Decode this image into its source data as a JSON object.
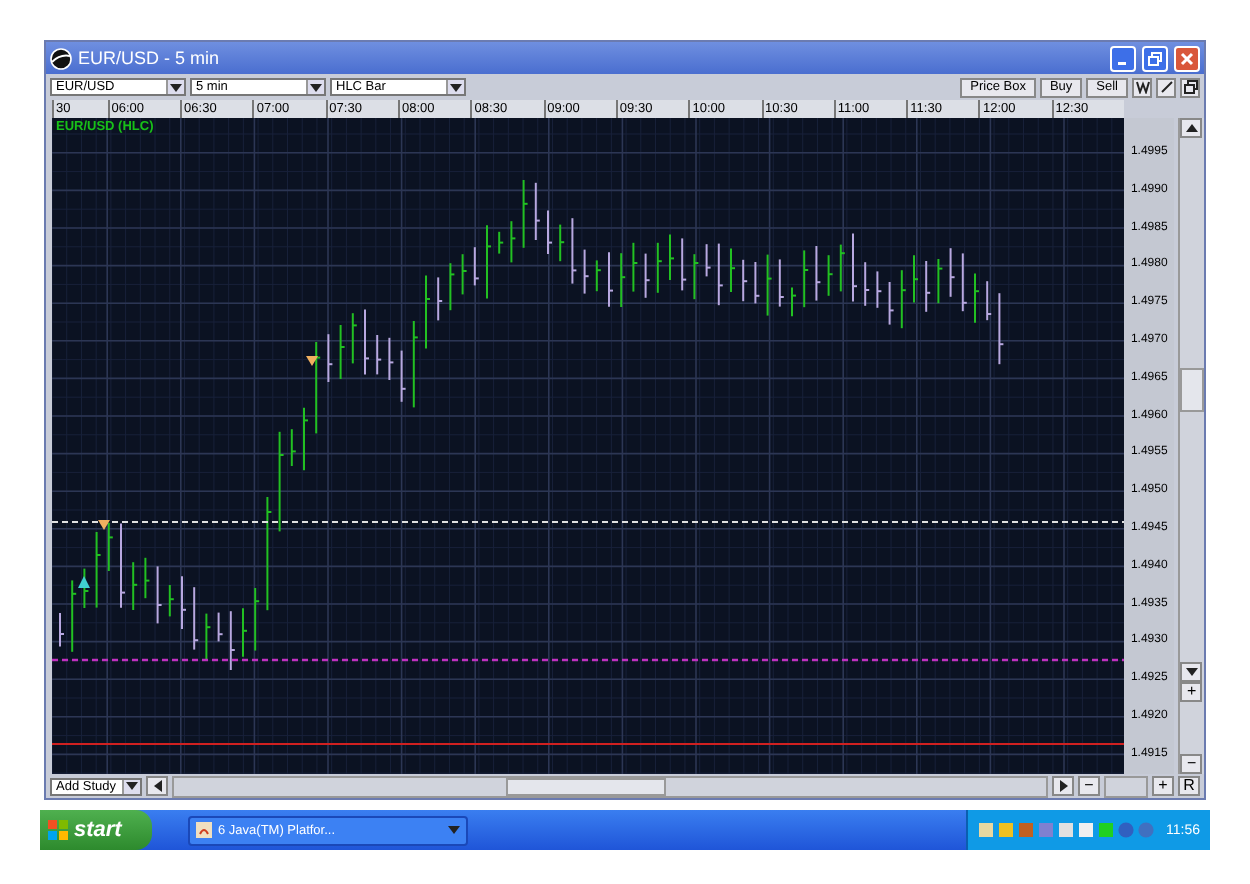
{
  "window": {
    "title": "EUR/USD - 5 min"
  },
  "toolbar": {
    "symbol": "EUR/USD",
    "interval": "5 min",
    "chart_type": "HLC Bar",
    "buttons": [
      "Price Box",
      "Buy",
      "Sell"
    ]
  },
  "time_axis": [
    "30",
    "06:00",
    "06:30",
    "07:00",
    "07:30",
    "08:00",
    "08:30",
    "09:00",
    "09:30",
    "10:00",
    "10:30",
    "11:00",
    "11:30",
    "12:00",
    "12:30"
  ],
  "chart": {
    "label": "EUR/USD (HLC)",
    "price_axis": [
      "1.4995",
      "1.4990",
      "1.4985",
      "1.4980",
      "1.4975",
      "1.4970",
      "1.4965",
      "1.4960",
      "1.4955",
      "1.4950",
      "1.4945",
      "1.4940",
      "1.4935",
      "1.4930",
      "1.4925",
      "1.4920",
      "1.4915"
    ]
  },
  "side_zoom": {
    "zoom_in": "+",
    "zoom_out": "−"
  },
  "bottom_bar": {
    "add_study": "Add Study",
    "zoom_out": "−",
    "zoom_in": "+",
    "reset": "R"
  },
  "taskbar": {
    "start": "start",
    "tasks": [
      {
        "label": "6 Java(TM) Platfor..."
      }
    ],
    "clock": "11:56"
  }
}
